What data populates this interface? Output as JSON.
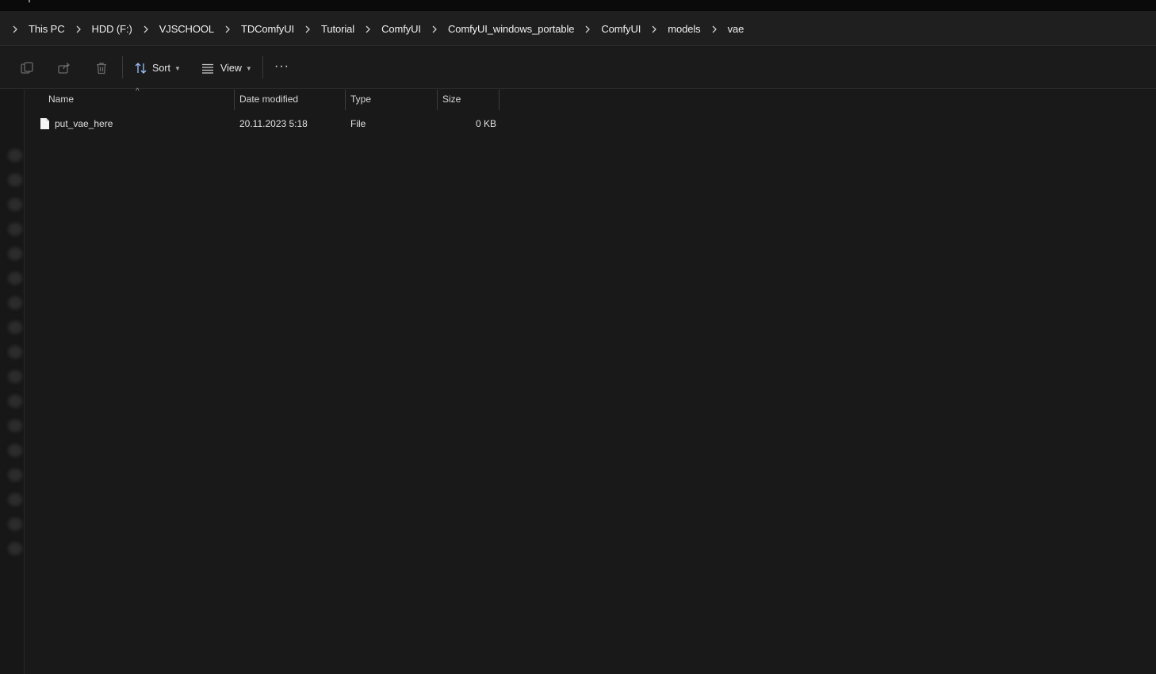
{
  "breadcrumb": [
    "This PC",
    "HDD (F:)",
    "VJSCHOOL",
    "TDComfyUI",
    "Tutorial",
    "ComfyUI",
    "ComfyUI_windows_portable",
    "ComfyUI",
    "models",
    "vae"
  ],
  "toolbar": {
    "sort_label": "Sort",
    "view_label": "View",
    "more_label": "···"
  },
  "columns": {
    "name": "Name",
    "date": "Date modified",
    "type": "Type",
    "size": "Size"
  },
  "files": [
    {
      "name": "put_vae_here",
      "date": "20.11.2023 5:18",
      "type": "File",
      "size": "0 KB"
    }
  ],
  "icons": {
    "breadcrumb_separator": "chevron-right-icon",
    "copy": "copy-icon",
    "share": "share-icon",
    "delete": "trash-icon",
    "sort": "sort-icon",
    "view": "view-list-icon",
    "more": "more-icon",
    "file": "file-icon"
  },
  "colors": {
    "background": "#191919",
    "toolbar": "#1b1b1b",
    "text": "#e6e6e6"
  }
}
